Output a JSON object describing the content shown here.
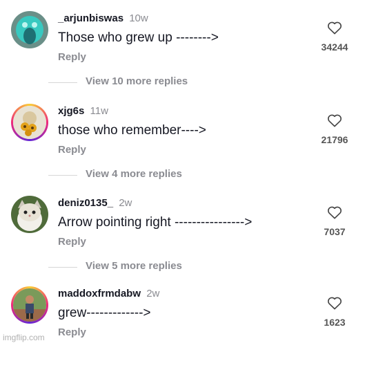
{
  "comments": [
    {
      "username": "_arjunbiswas",
      "time": "10w",
      "text": "Those who grew up -------->",
      "reply": "Reply",
      "likes": "34244",
      "view_more": "View 10 more replies"
    },
    {
      "username": "xjg6s",
      "time": "11w",
      "text": "those who remember---->",
      "reply": "Reply",
      "likes": "21796",
      "view_more": "View 4 more replies"
    },
    {
      "username": "deniz0135_",
      "time": "2w",
      "text": "Arrow pointing right ---------------->",
      "reply": "Reply",
      "likes": "7037",
      "view_more": "View 5 more replies"
    },
    {
      "username": "maddoxfrmdabw",
      "time": "2w",
      "text": "grew------------->",
      "reply": "Reply",
      "likes": "1623"
    }
  ],
  "watermark": "imgflip.com",
  "icons": {
    "like": "heart-outline-icon"
  }
}
